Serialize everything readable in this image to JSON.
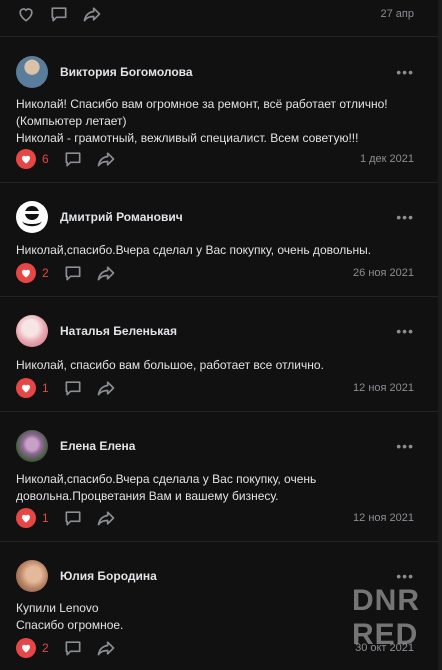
{
  "top_post": {
    "date": "27 апр"
  },
  "comments": [
    {
      "name": "Виктория Богомолова",
      "lines": [
        "Николай! Спасибо вам огромное за ремонт, всё работает отлично!",
        "(Компьютер летает)",
        "Николай - грамотный, вежливый специалист. Всем советую!!!"
      ],
      "likes": "6",
      "date": "1 дек 2021"
    },
    {
      "name": "Дмитрий Романович",
      "lines": [
        "Николай,спасибо.Вчера сделал у Вас покупку, очень довольны."
      ],
      "likes": "2",
      "date": "26 ноя 2021"
    },
    {
      "name": "Наталья Беленькая",
      "lines": [
        "Николай, спасибо вам большое, работает все отлично."
      ],
      "likes": "1",
      "date": "12 ноя 2021"
    },
    {
      "name": "Елена Елена",
      "lines": [
        "Николай,спасибо.Вчера сделала у Вас покупку, очень",
        "довольна.Процветания Вам и вашему бизнесу."
      ],
      "likes": "1",
      "date": "12 ноя 2021"
    },
    {
      "name": "Юлия Бородина",
      "lines": [
        "Купили Lenovo",
        "Спасибо огромное."
      ],
      "likes": "2",
      "date": "30 окт 2021"
    }
  ],
  "watermark": {
    "line1": "DNR",
    "line2": "RED"
  },
  "colors": {
    "background": "#111111",
    "like": "#e64646",
    "muted": "#8b8e93",
    "text": "#e1e3e6"
  }
}
